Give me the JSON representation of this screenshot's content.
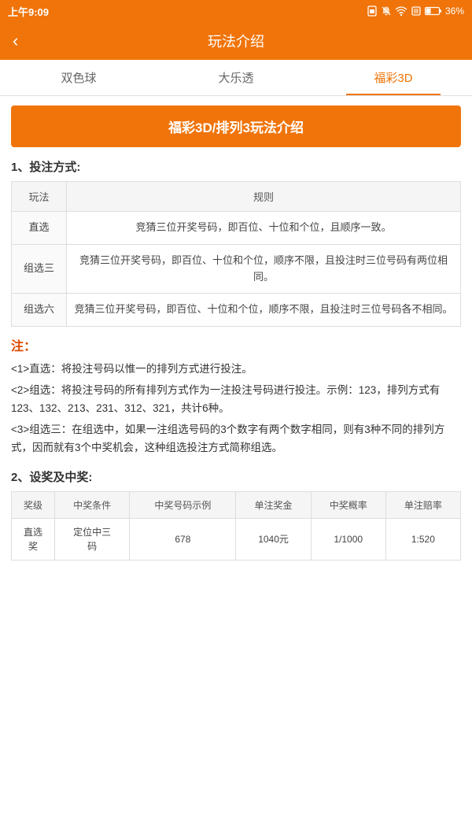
{
  "statusBar": {
    "time": "上午9:09",
    "icons": [
      "sim",
      "bell-off",
      "wifi",
      "screenshot",
      "battery"
    ],
    "battery": "36%"
  },
  "header": {
    "title": "玩法介绍",
    "backLabel": "‹"
  },
  "tabs": [
    {
      "id": "tab-shuangseqiu",
      "label": "双色球",
      "active": false
    },
    {
      "id": "tab-daletou",
      "label": "大乐透",
      "active": false
    },
    {
      "id": "tab-fucai3d",
      "label": "福彩3D",
      "active": true
    }
  ],
  "banner": {
    "text": "福彩3D/排列3玩法介绍"
  },
  "section1": {
    "title": "1、投注方式:",
    "tableHeaders": [
      "玩法",
      "规则"
    ],
    "rows": [
      {
        "name": "直选",
        "rule": "竞猜三位开奖号码，即百位、十位和个位，且顺序一致。"
      },
      {
        "name": "组选三",
        "rule": "竞猜三位开奖号码，即百位、十位和个位，顺序不限，且投注时三位号码有两位相同。"
      },
      {
        "name": "组选六",
        "rule": "竞猜三位开奖号码，即百位、十位和个位，顺序不限，且投注时三位号码各不相同。"
      }
    ]
  },
  "notes": {
    "title": "注：",
    "items": [
      "<1>直选：将投注号码以惟一的排列方式进行投注。",
      "<2>组选：将投注号码的所有排列方式作为一注投注号码进行投注。示例：123，排列方式有123、132、213、231、312、321，共计6种。",
      "<3>组选三：在组选中，如果一注组选号码的3个数字有两个数字相同，则有3种不同的排列方式，因而就有3个中奖机会，这种组选投注方式简称组选。"
    ]
  },
  "section2": {
    "title": "2、设奖及中奖:",
    "tableHeaders": [
      "奖级",
      "中奖条件",
      "中奖号码示例",
      "单注奖金",
      "中奖概率",
      "单注赔率"
    ],
    "rows": [
      {
        "level": "直选奖",
        "condition": "定位中三码",
        "example": "678",
        "prize": "1040元",
        "odds": "1/1000",
        "payout": "1:520"
      }
    ]
  }
}
